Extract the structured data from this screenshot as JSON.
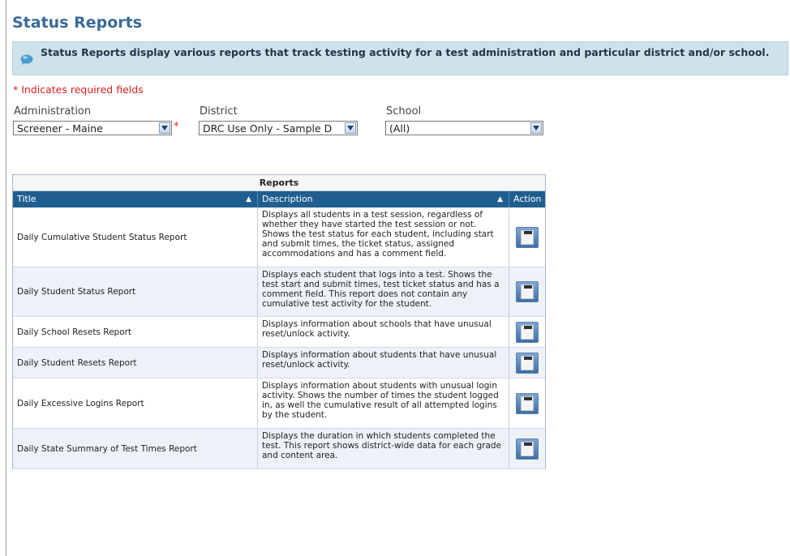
{
  "page": {
    "title": "Status Reports",
    "info_text": "Status Reports display various reports that track testing activity for a test administration and particular district and/or school.",
    "required_note": "* Indicates required fields"
  },
  "filters": {
    "administration": {
      "label": "Administration",
      "value": "Screener - Maine",
      "required_star": "*"
    },
    "district": {
      "label": "District",
      "value": "DRC Use Only - Sample D"
    },
    "school": {
      "label": "School",
      "value": "(All)"
    }
  },
  "reports": {
    "caption": "Reports",
    "columns": {
      "title": "Title",
      "description": "Description",
      "action": "Action"
    },
    "rows": [
      {
        "title": "Daily Cumulative Student Status Report",
        "description": "Displays all students in a test session, regardless of whether they have started the test session or not. Shows the test status for each student, including start and submit times, the ticket status, assigned accommodations and has a comment field."
      },
      {
        "title": "Daily Student Status Report",
        "description": "Displays each student that logs into a test. Shows the test start and submit times, test ticket status and has a comment field. This report does not contain any cumulative test activity for the student."
      },
      {
        "title": "Daily School Resets Report",
        "description": "Displays information about schools that have unusual reset/unlock activity."
      },
      {
        "title": "Daily Student Resets Report",
        "description": "Displays information about students that have unusual reset/unlock activity."
      },
      {
        "title": "Daily Excessive Logins Report",
        "description": "Displays information about students with unusual login activity. Shows the number of times the student logged in, as well the cumulative result of all attempted logins by the student."
      },
      {
        "title": "Daily State Summary of Test Times Report",
        "description": "Displays the duration in which students completed the test. This report shows district-wide data for each grade and content area."
      }
    ]
  },
  "colors": {
    "title": "#3a6a9a",
    "banner_bg": "#cfe2ea",
    "header_bg": "#1f5f8f",
    "required": "#e02020"
  },
  "icons": {
    "info": "speech-bubble-icon",
    "dropdown": "chevron-down-icon",
    "sort": "triangle-up-icon",
    "action": "csv-download-icon"
  }
}
